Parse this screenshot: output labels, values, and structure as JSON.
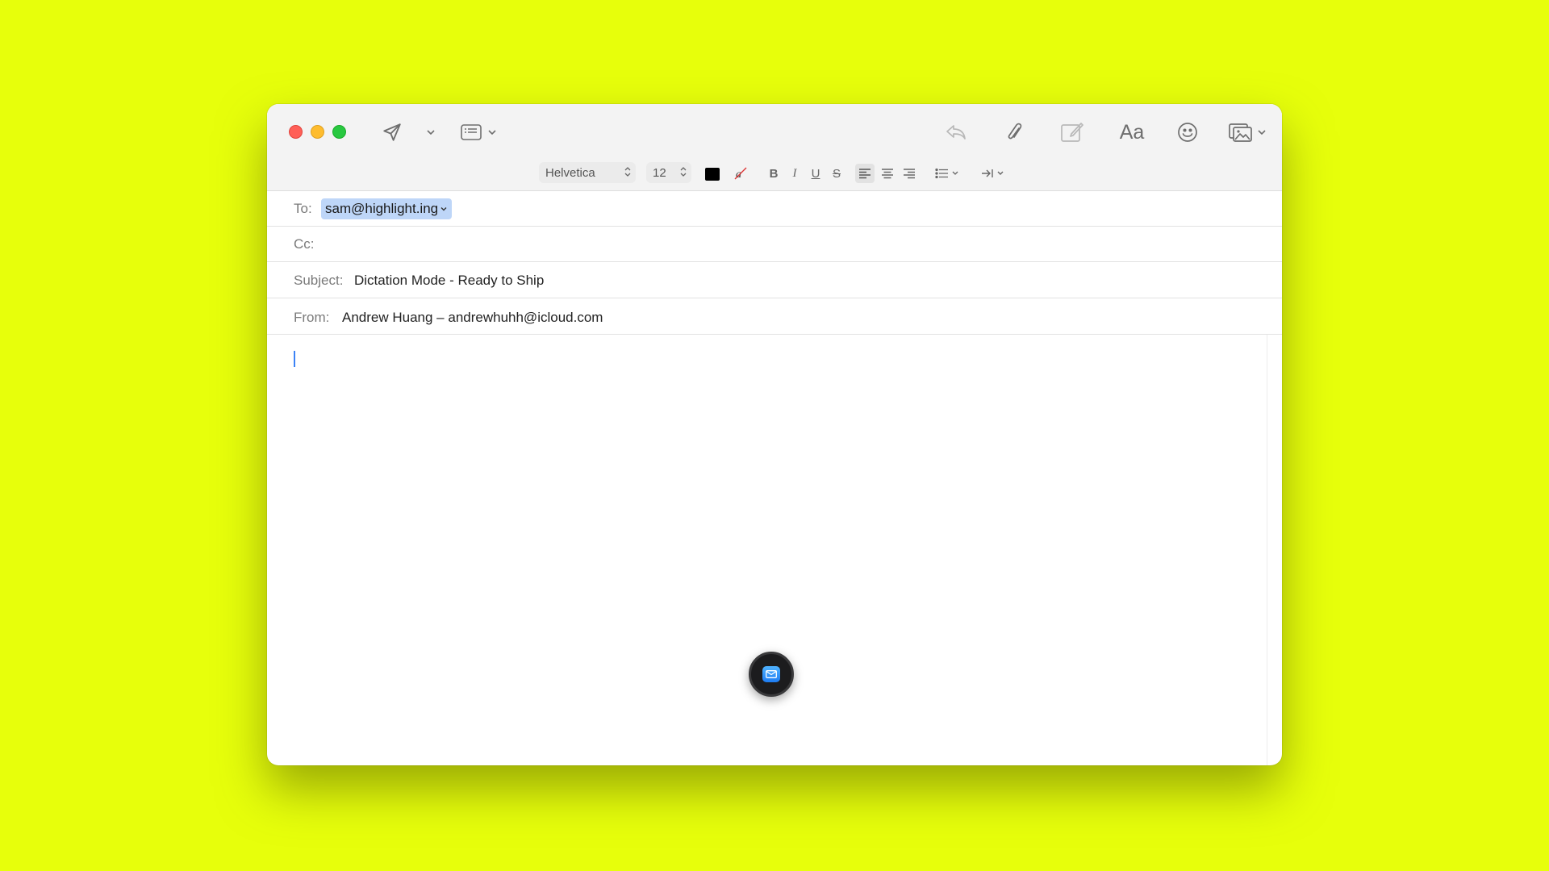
{
  "window": {
    "traffic_lights": [
      "close",
      "minimize",
      "zoom"
    ]
  },
  "toolbar": {
    "icons": {
      "send": "send-icon",
      "send_menu": "chevron-down-icon",
      "header_fields": "header-fields-icon",
      "reply": "reply-icon",
      "attach": "paperclip-icon",
      "markup": "markup-icon",
      "format": "Aa",
      "emoji": "smiley-icon",
      "photo": "photo-browser-icon"
    }
  },
  "format_bar": {
    "font": "Helvetica",
    "size": "12",
    "text_color": "#000000",
    "bold": "B",
    "italic": "I",
    "underline": "U",
    "strike": "S"
  },
  "fields": {
    "to_label": "To:",
    "to_value": "sam@highlight.ing",
    "cc_label": "Cc:",
    "subject_label": "Subject:",
    "subject_value": "Dictation Mode - Ready to Ship",
    "from_label": "From:",
    "from_value": "Andrew Huang – andrewhuhh@icloud.com"
  },
  "colors": {
    "background": "#e7ff0b",
    "token_bg": "#bed6f8",
    "accent": "#3b82f6"
  }
}
